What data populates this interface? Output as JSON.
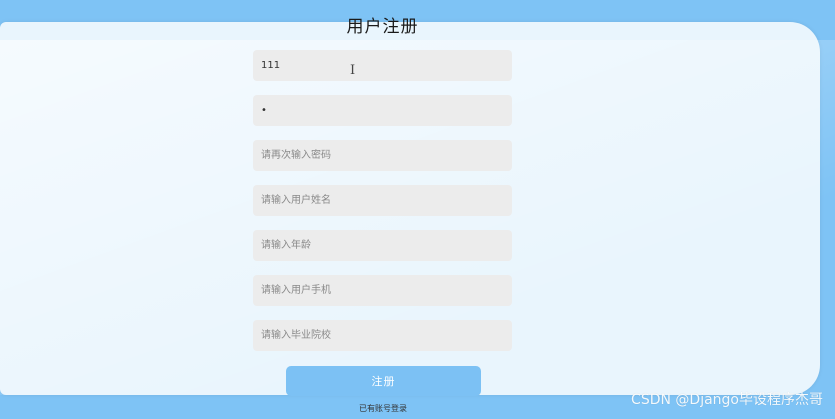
{
  "page": {
    "title": "用户注册"
  },
  "form": {
    "username": {
      "value": "111",
      "placeholder": ""
    },
    "password": {
      "value": "•",
      "placeholder": ""
    },
    "confirm_password": {
      "value": "",
      "placeholder": "请再次输入密码"
    },
    "user_name": {
      "value": "",
      "placeholder": "请输入用户姓名"
    },
    "age": {
      "value": "",
      "placeholder": "请输入年龄"
    },
    "phone": {
      "value": "",
      "placeholder": "请输入用户手机"
    },
    "school": {
      "value": "",
      "placeholder": "请输入毕业院校"
    },
    "submit_label": "注册",
    "login_link": "已有账号登录"
  },
  "watermark": "CSDN @Django毕设程序杰哥",
  "colors": {
    "accent": "#7ec3f5",
    "panel": "#e9f5fd",
    "field": "#ececec"
  }
}
